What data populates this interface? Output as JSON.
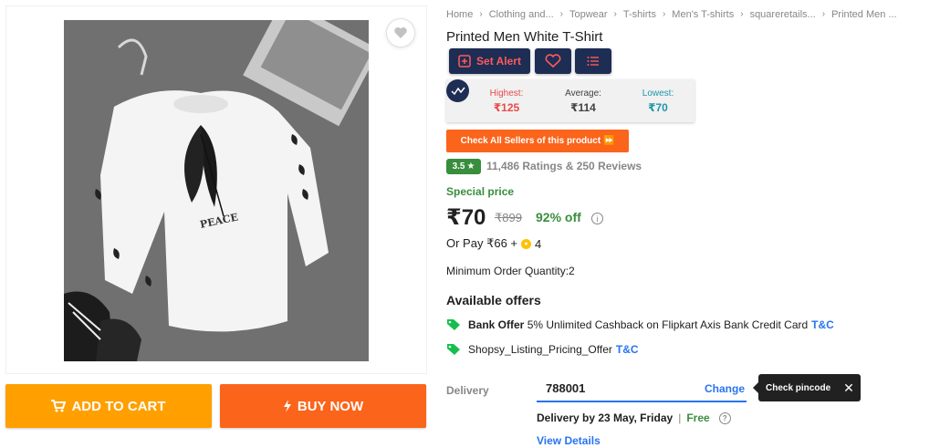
{
  "breadcrumb": [
    "Home",
    "Clothing and...",
    "Topwear",
    "T-shirts",
    "Men's T-shirts",
    "squareretails...",
    "Printed Men ..."
  ],
  "product": {
    "title": "Printed Men White T-Shirt",
    "image_text": "PEACE"
  },
  "tools": {
    "set_alert": "Set Alert",
    "heart_icon": "heart-icon",
    "list_icon": "list-icon"
  },
  "price_history": {
    "highest_label": "Highest:",
    "highest_value": "₹125",
    "average_label": "Average:",
    "average_value": "₹114",
    "lowest_label": "Lowest:",
    "lowest_value": "₹70"
  },
  "sellers_button": "Check All Sellers of this product ⏩",
  "rating": {
    "value": "3.5",
    "summary": "11,486 Ratings & 250 Reviews"
  },
  "pricing": {
    "special_label": "Special price",
    "price": "₹70",
    "mrp": "₹899",
    "discount": "92% off",
    "or_pay": "Or Pay ₹66 +",
    "coins": "4"
  },
  "min_order": "Minimum Order Quantity:2",
  "offers": {
    "title": "Available offers",
    "items": [
      {
        "bold": "Bank Offer",
        "text": "5% Unlimited Cashback on Flipkart Axis Bank Credit Card",
        "link": "T&C"
      },
      {
        "bold": "",
        "text": "Shopsy_Listing_Pricing_Offer",
        "link": "T&C"
      }
    ]
  },
  "delivery": {
    "label": "Delivery",
    "pincode": "788001",
    "change": "Change",
    "tooltip": "Check pincode",
    "date": "Delivery by 23 May, Friday",
    "separator": "|",
    "free": "Free",
    "view_details": "View Details"
  },
  "actions": {
    "add_to_cart": "ADD TO CART",
    "buy_now": "BUY NOW"
  },
  "colors": {
    "cart": "#ff9f00",
    "buy": "#fb641b",
    "green": "#388e3c",
    "link": "#2874f0",
    "navy": "#1e2d54"
  }
}
